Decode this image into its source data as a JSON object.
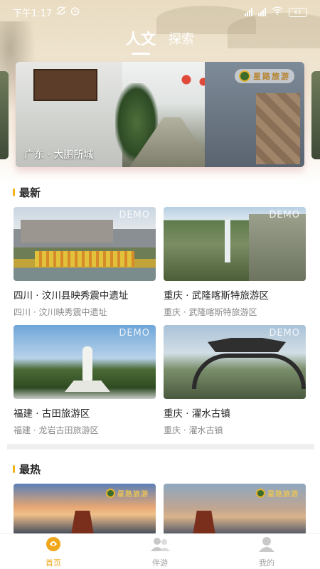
{
  "status_bar": {
    "time": "下午1:17",
    "battery": "61"
  },
  "top_tabs": [
    {
      "label": "人文",
      "active": true
    },
    {
      "label": "探索",
      "active": false
    }
  ],
  "banner": {
    "caption": "广东 · 大鹏所城",
    "logo_text": "星路旅游"
  },
  "latest": {
    "title": "最新",
    "watermark": "DEMO",
    "cards": [
      {
        "title": "四川 · 汶川县映秀震中遗址",
        "subtitle": "四川 · 汶川映秀震中遗址"
      },
      {
        "title": "重庆 · 武隆喀斯特旅游区",
        "subtitle": "重庆 · 武隆喀斯特旅游区"
      },
      {
        "title": "福建 · 古田旅游区",
        "subtitle": "福建 · 龙岩古田旅游区"
      },
      {
        "title": "重庆 · 濯水古镇",
        "subtitle": "重庆 · 濯水古镇"
      }
    ]
  },
  "hottest": {
    "title": "最热",
    "logo_text": "星路旅游"
  },
  "bottom_nav": [
    {
      "label": "首页",
      "icon": "home-icon",
      "active": true
    },
    {
      "label": "伴游",
      "icon": "companion-icon",
      "active": false
    },
    {
      "label": "我的",
      "icon": "profile-icon",
      "active": false
    }
  ],
  "colors": {
    "accent": "#f1a71a",
    "section_bar": "#f1b21a",
    "inactive": "#a4a4a4"
  }
}
